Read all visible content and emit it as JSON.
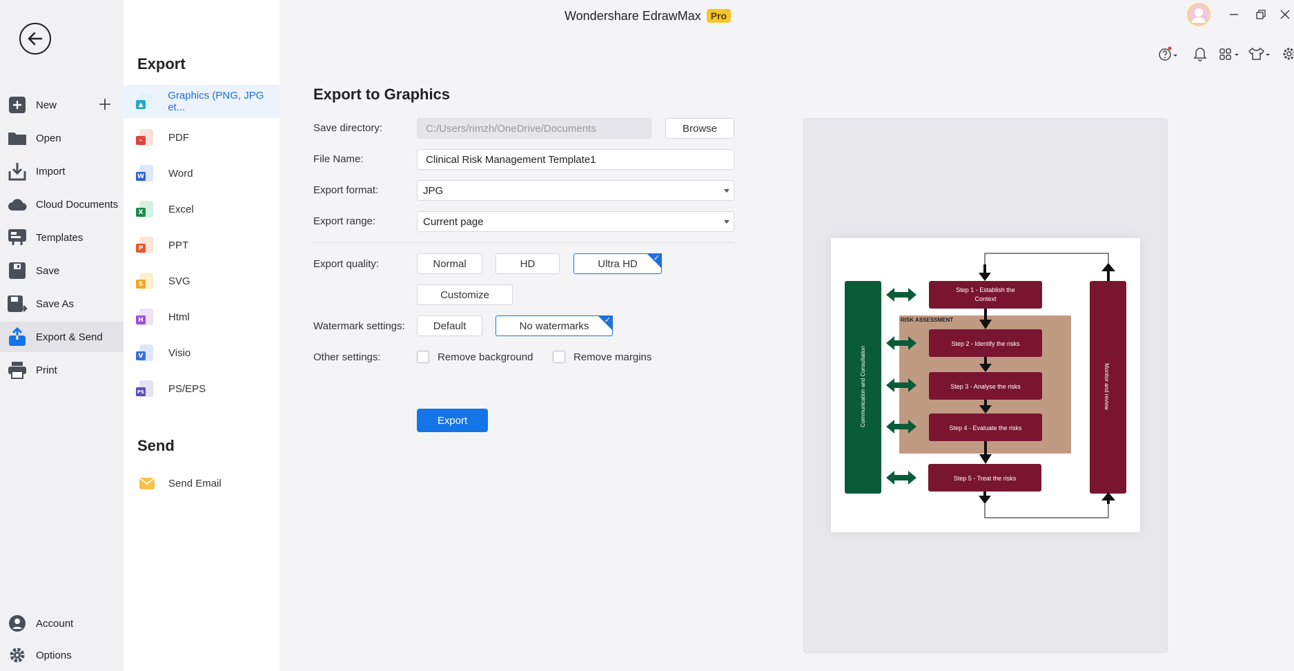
{
  "app": {
    "title": "Wondershare EdrawMax",
    "badge": "Pro"
  },
  "nav": {
    "items": [
      {
        "label": "New"
      },
      {
        "label": "Open"
      },
      {
        "label": "Import"
      },
      {
        "label": "Cloud Documents"
      },
      {
        "label": "Templates"
      },
      {
        "label": "Save"
      },
      {
        "label": "Save As"
      },
      {
        "label": "Export & Send"
      },
      {
        "label": "Print"
      }
    ],
    "bottom": [
      {
        "label": "Account"
      },
      {
        "label": "Options"
      }
    ]
  },
  "export_section": {
    "title": "Export",
    "types": [
      {
        "label": "Graphics (PNG, JPG et..."
      },
      {
        "label": "PDF"
      },
      {
        "label": "Word"
      },
      {
        "label": "Excel"
      },
      {
        "label": "PPT"
      },
      {
        "label": "SVG"
      },
      {
        "label": "Html"
      },
      {
        "label": "Visio"
      },
      {
        "label": "PS/EPS"
      }
    ]
  },
  "send_section": {
    "title": "Send",
    "items": [
      {
        "label": "Send Email"
      }
    ]
  },
  "form": {
    "title": "Export to Graphics",
    "save_directory": {
      "label": "Save directory:",
      "value": "C:/Users/rimzh/OneDrive/Documents",
      "browse": "Browse"
    },
    "file_name": {
      "label": "File Name:",
      "value": "Clinical Risk Management Template1"
    },
    "export_format": {
      "label": "Export format:",
      "value": "JPG"
    },
    "export_range": {
      "label": "Export range:",
      "value": "Current page"
    },
    "export_quality": {
      "label": "Export quality:",
      "options": [
        "Normal",
        "HD",
        "Ultra HD"
      ],
      "selected": "Ultra HD",
      "customize": "Customize"
    },
    "watermark": {
      "label": "Watermark settings:",
      "options": [
        "Default",
        "No watermarks"
      ],
      "selected": "No watermarks"
    },
    "other": {
      "label": "Other settings:",
      "remove_background": "Remove background",
      "remove_margins": "Remove margins"
    },
    "export_button": "Export"
  },
  "preview": {
    "left_bar": "Communication and Consultation",
    "right_bar": "Monitor and review",
    "assessment_label": "RISK ASSESSMENT",
    "steps": [
      "Step 1 - Establish the",
      "Context",
      "Step 2 - Identify the risks",
      "Step 3 - Analyse the risks",
      "Step 4 - Evaluate the risks",
      "Step 5 - Treat the risks"
    ]
  },
  "colors": {
    "accent": "#1574e8",
    "green_bar": "#0a5c38",
    "maroon": "#7a1531",
    "assessment_bg": "#c09a83"
  }
}
